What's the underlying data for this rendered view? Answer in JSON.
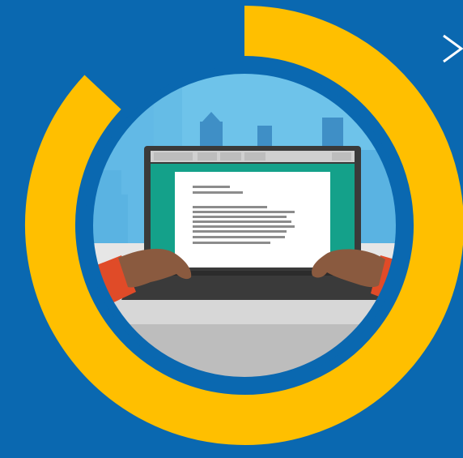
{
  "scene": {
    "description": "",
    "background_color": "#0a68b0",
    "ring_color": "#ffbf00",
    "ring_gap_color": "#0a68b0",
    "sky_color": "#6ec3ea",
    "building_color_light": "#5ab3e2",
    "building_color_dark": "#3f8fc6",
    "floor_color": "#d7d7d7",
    "laptop_frame_color": "#3a3a3a",
    "screen_teal_color": "#14a18a",
    "document_color": "#ffffff",
    "text_line_color": "#8c8c8c",
    "skin_color": "#8a5a3f",
    "sleeve_color": "#e04b28",
    "sleeve_blue_color": "#3a7bd5",
    "ring_fill_fraction": 0.87
  },
  "nav": {
    "chevron_glyph": ">",
    "chevron_icon": "chevron-right-icon"
  }
}
